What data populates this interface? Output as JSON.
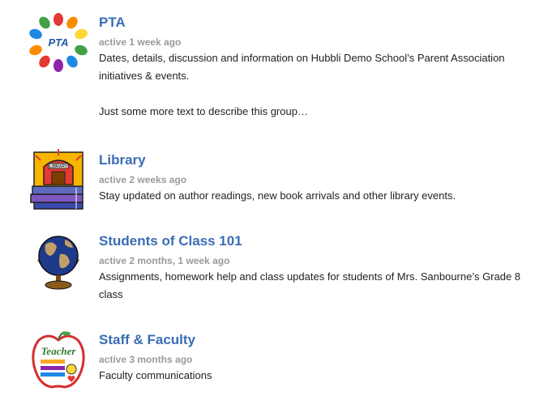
{
  "groups": [
    {
      "name": "PTA",
      "activity": "active 1 week ago",
      "description": "Dates, details, discussion and information on Hubbli Demo School’s Parent Association initiatives & events.",
      "description_extra": "Just some more text to describe this group…",
      "avatar_label": "PTA",
      "avatar_icon": "pta-hands-logo-icon"
    },
    {
      "name": "Library",
      "activity": "active 2 weeks ago",
      "description": "Stay updated on author readings, new book arrivals and other library events.",
      "avatar_label": "LIBRARY",
      "avatar_icon": "library-books-icon"
    },
    {
      "name": "Students of Class 101",
      "activity": "active 2 months, 1 week ago",
      "description": "Assignments, homework help and class updates for students of Mrs. Sanbourne’s Grade 8 class",
      "avatar_icon": "globe-icon"
    },
    {
      "name": "Staff & Faculty",
      "activity": "active 3 months ago",
      "description": "Faculty communications",
      "avatar_label": "Teacher",
      "avatar_icon": "teacher-apple-icon"
    }
  ],
  "colors": {
    "title": "#3a6cb5",
    "meta": "#9a9a9a",
    "text": "#222222"
  }
}
